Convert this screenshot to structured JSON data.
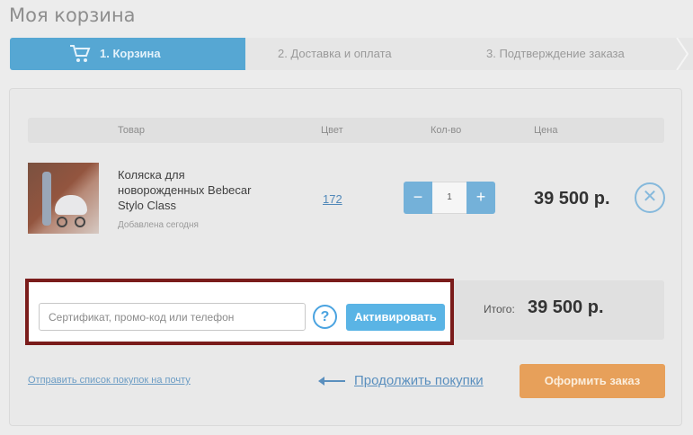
{
  "page": {
    "title": "Моя корзина"
  },
  "steps": [
    {
      "label": "1. Корзина",
      "icon": "cart-icon",
      "active": true
    },
    {
      "label": "2. Доставка и оплата",
      "active": false
    },
    {
      "label": "3. Подтверждение заказа",
      "active": false
    }
  ],
  "table": {
    "headers": {
      "product": "Товар",
      "color": "Цвет",
      "qty": "Кол-во",
      "price": "Цена"
    }
  },
  "item": {
    "name": "Коляска для новорожденных Bebecar Stylo Class",
    "added": "Добавлена сегодня",
    "color": "172",
    "quantity": "1",
    "minus": "−",
    "plus": "+",
    "price": "39 500 р.",
    "remove_icon": "close-icon"
  },
  "summary": {
    "total_label": "Итого:",
    "total_value": "39 500 р."
  },
  "promo": {
    "placeholder": "Сертификат, промо-код или телефон",
    "help": "?",
    "activate_label": "Активировать"
  },
  "footer": {
    "send_list": "Отправить список покупок на почту",
    "continue": "Продолжить покупки",
    "checkout": "Оформить заказ"
  },
  "colors": {
    "accent": "#56a7d3",
    "checkout": "#e7a05a",
    "highlight_frame": "#7a1c1b"
  }
}
